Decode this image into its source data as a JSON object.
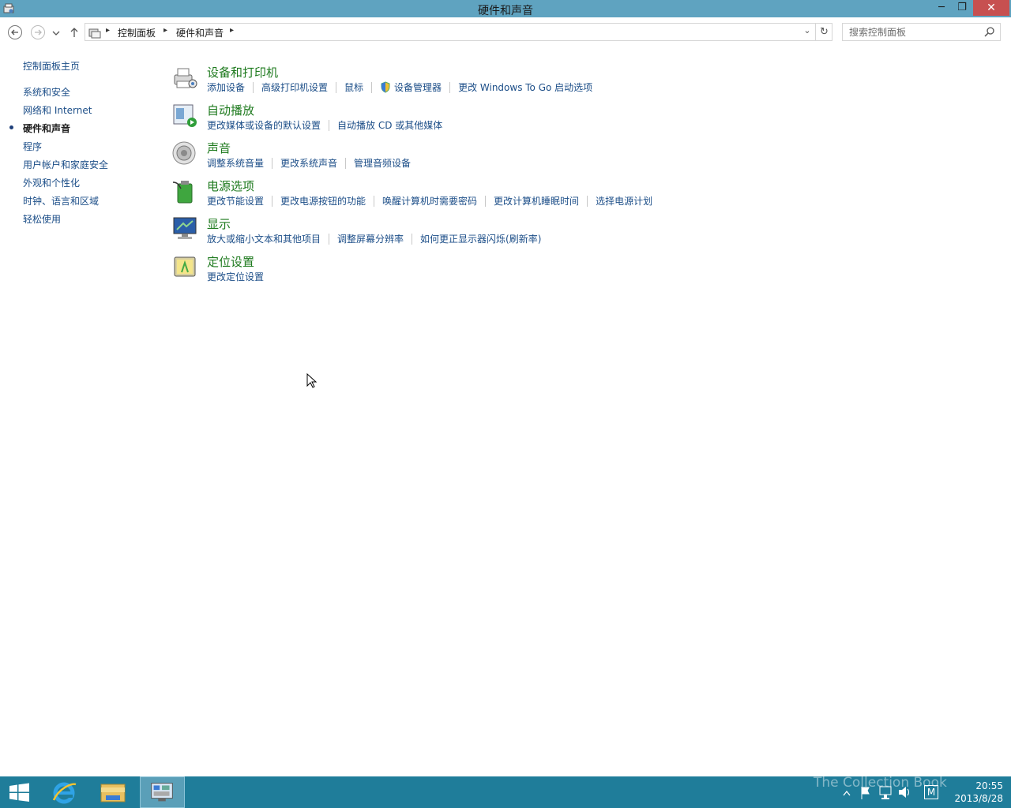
{
  "window": {
    "title": "硬件和声音",
    "min_glyph": "─",
    "max_glyph": "❐",
    "close_glyph": "✕"
  },
  "address": {
    "crumbs": [
      "控制面板",
      "硬件和声音"
    ],
    "search_placeholder": "搜索控制面板"
  },
  "leftnav": {
    "home": "控制面板主页",
    "items": [
      {
        "label": "系统和安全",
        "current": false
      },
      {
        "label": "网络和 Internet",
        "current": false
      },
      {
        "label": "硬件和声音",
        "current": true
      },
      {
        "label": "程序",
        "current": false
      },
      {
        "label": "用户帐户和家庭安全",
        "current": false
      },
      {
        "label": "外观和个性化",
        "current": false
      },
      {
        "label": "时钟、语言和区域",
        "current": false
      },
      {
        "label": "轻松使用",
        "current": false
      }
    ]
  },
  "categories": [
    {
      "title": "设备和打印机",
      "icon": "printer-icon",
      "links": [
        "添加设备",
        "高级打印机设置",
        "鼠标",
        "设备管理器",
        "更改 Windows To Go 启动选项"
      ]
    },
    {
      "title": "自动播放",
      "icon": "autoplay-icon",
      "links": [
        "更改媒体或设备的默认设置",
        "自动播放 CD 或其他媒体"
      ]
    },
    {
      "title": "声音",
      "icon": "speaker-icon",
      "links": [
        "调整系统音量",
        "更改系统声音",
        "管理音频设备"
      ]
    },
    {
      "title": "电源选项",
      "icon": "battery-icon",
      "links": [
        "更改节能设置",
        "更改电源按钮的功能",
        "唤醒计算机时需要密码",
        "更改计算机睡眠时间",
        "选择电源计划"
      ]
    },
    {
      "title": "显示",
      "icon": "monitor-icon",
      "links": [
        "放大或缩小文本和其他项目",
        "调整屏幕分辨率",
        "如何更正显示器闪烁(刷新率)"
      ]
    },
    {
      "title": "定位设置",
      "icon": "location-icon",
      "links": [
        "更改定位设置"
      ]
    }
  ],
  "taskbar": {
    "time": "20:55",
    "date": "2013/8/28",
    "watermark": "The Collection Book"
  },
  "colors": {
    "titlebar": "#5fa3c0",
    "taskbar": "#1f7d9a",
    "link": "#1c4e88",
    "category_title": "#1e7a1e"
  }
}
